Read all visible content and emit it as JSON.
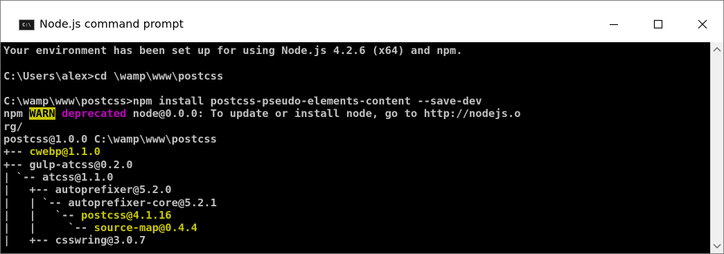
{
  "window": {
    "icon_text": "C:\\",
    "title": "Node.js command prompt"
  },
  "terminal": {
    "lines": [
      [
        {
          "t": "Your environment has been set up for using Node.js 4.2.6 (x64) and npm.",
          "c": "normal"
        }
      ],
      [
        {
          "t": "",
          "c": "normal"
        }
      ],
      [
        {
          "t": "C:\\Users\\alex>cd \\wamp\\www\\postcss",
          "c": "normal"
        }
      ],
      [
        {
          "t": "",
          "c": "normal"
        }
      ],
      [
        {
          "t": "C:\\wamp\\www\\postcss>npm install postcss-pseudo-elements-content --save-dev",
          "c": "normal"
        }
      ],
      [
        {
          "t": "npm ",
          "c": "normal"
        },
        {
          "t": "WARN",
          "c": "warn"
        },
        {
          "t": " ",
          "c": "normal"
        },
        {
          "t": "deprecated",
          "c": "magenta"
        },
        {
          "t": " node@0.0.0: To update or install node, go to http://nodejs.o",
          "c": "normal"
        }
      ],
      [
        {
          "t": "rg/",
          "c": "normal"
        }
      ],
      [
        {
          "t": "postcss@1.0.0 C:\\wamp\\www\\postcss",
          "c": "normal"
        }
      ],
      [
        {
          "t": "+-- ",
          "c": "normal"
        },
        {
          "t": "cwebp@1.1.0",
          "c": "olive"
        }
      ],
      [
        {
          "t": "+-- gulp-atcss@0.2.0",
          "c": "normal"
        }
      ],
      [
        {
          "t": "| `-- atcss@1.1.0",
          "c": "normal"
        }
      ],
      [
        {
          "t": "|   +-- autoprefixer@5.2.0",
          "c": "normal"
        }
      ],
      [
        {
          "t": "|   | `-- autoprefixer-core@5.2.1",
          "c": "normal"
        }
      ],
      [
        {
          "t": "|   |   `-- ",
          "c": "normal"
        },
        {
          "t": "postcss@4.1.16",
          "c": "olive"
        }
      ],
      [
        {
          "t": "|   |     `-- ",
          "c": "normal"
        },
        {
          "t": "source-map@0.4.4",
          "c": "olive"
        }
      ],
      [
        {
          "t": "|   +-- csswring@3.0.7",
          "c": "normal"
        }
      ]
    ]
  },
  "colors": {
    "normal": "#c0c0c0",
    "olive": "#c8c800",
    "magenta": "#c000c0",
    "warn_bg": "#c8c800",
    "warn_fg": "#000000"
  }
}
